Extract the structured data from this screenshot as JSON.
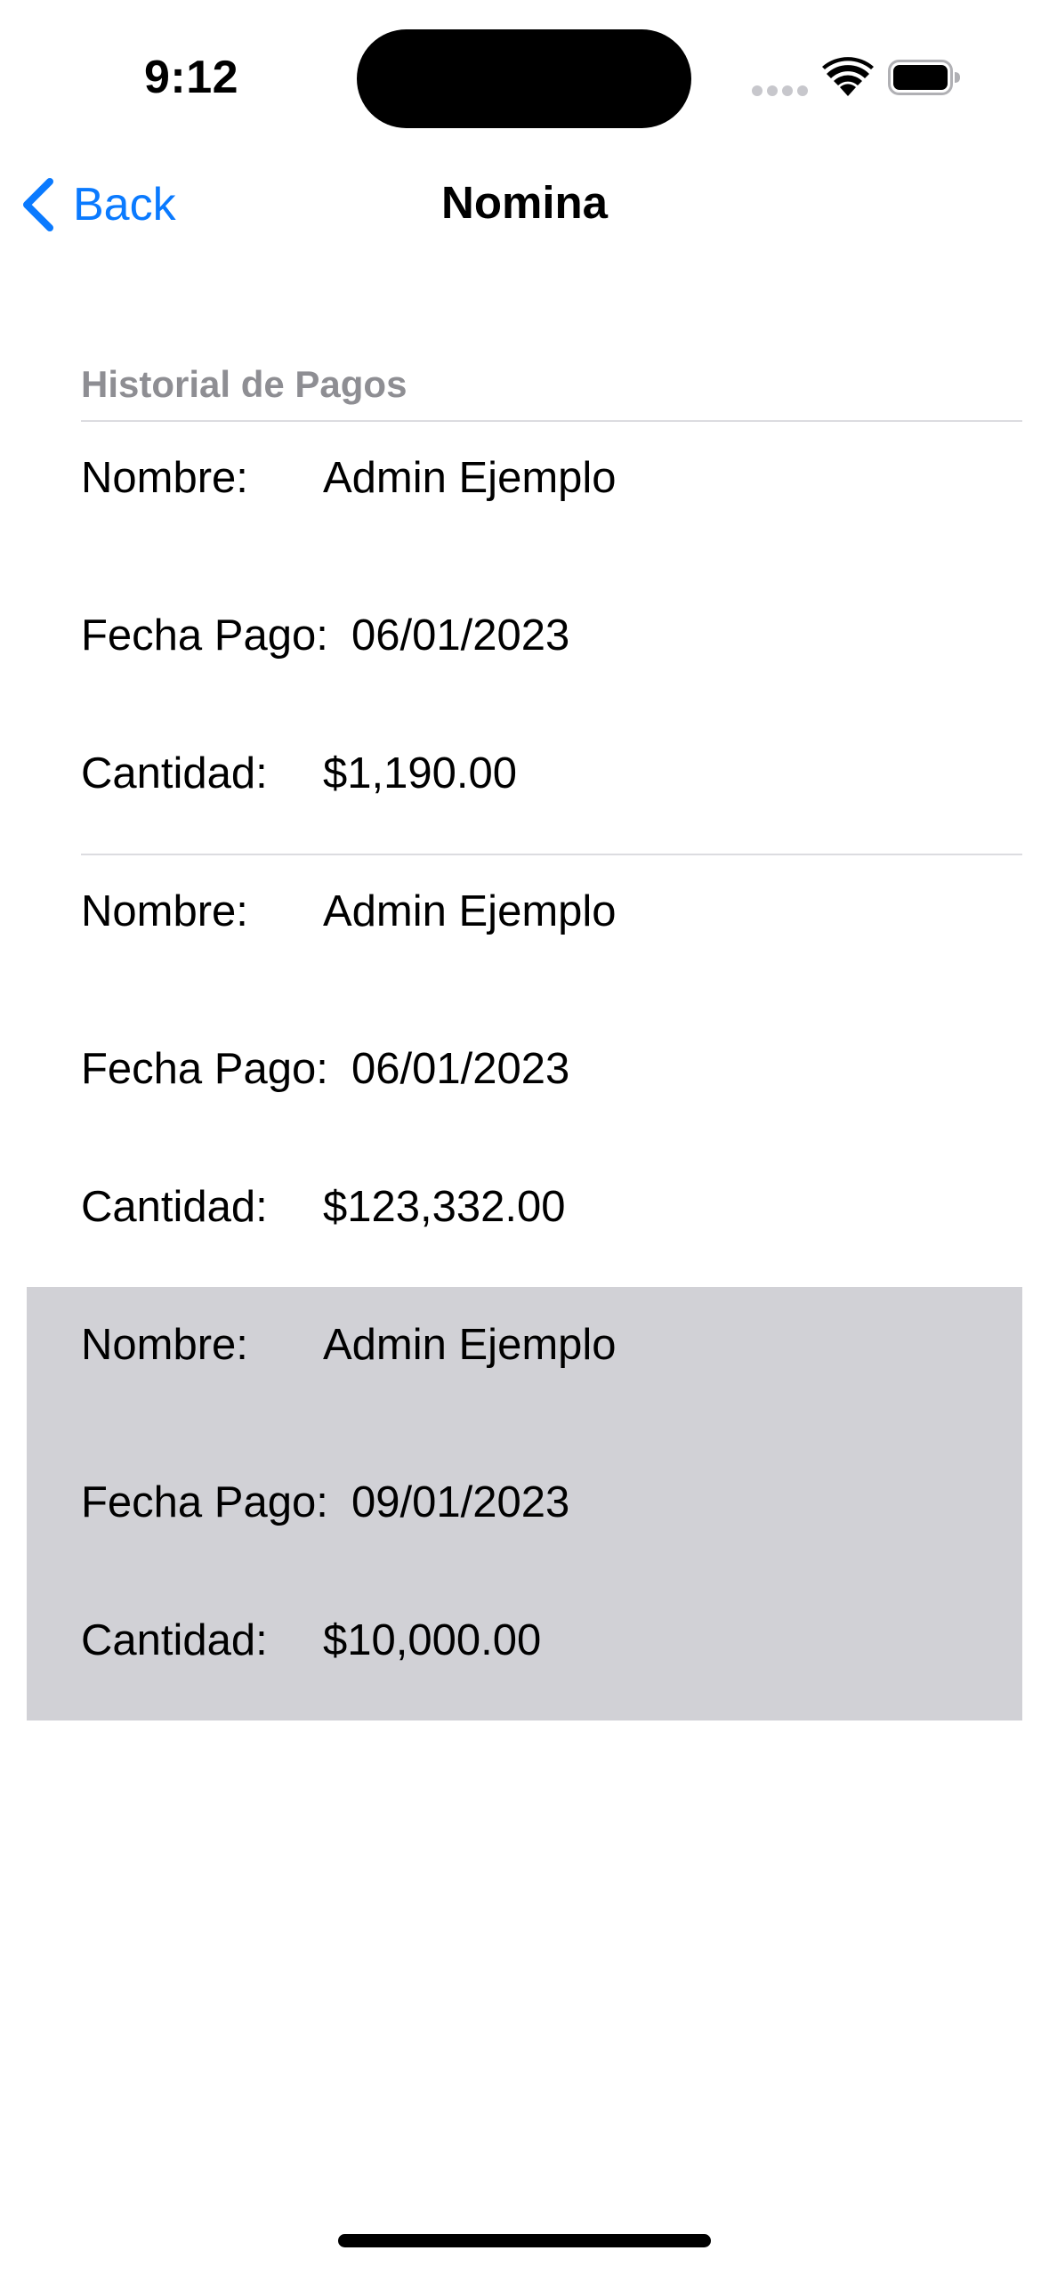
{
  "status_bar": {
    "time": "9:12",
    "icons": [
      "signal-dots-icon",
      "wifi-icon",
      "battery-icon"
    ]
  },
  "nav": {
    "back_label": "Back",
    "back_icon": "chevron-left-icon",
    "title": "Nomina",
    "accent_color": "#0a7aff"
  },
  "section": {
    "header": "Historial de Pagos"
  },
  "records": [
    {
      "name_label": "Nombre:",
      "name": "Admin Ejemplo",
      "date_label": "Fecha Pago:",
      "date": "06/01/2023",
      "amount_label": "Cantidad:",
      "amount": "$1,190.00",
      "selected": false
    },
    {
      "name_label": "Nombre:",
      "name": "Admin Ejemplo",
      "date_label": "Fecha Pago:",
      "date": "06/01/2023",
      "amount_label": "Cantidad:",
      "amount": "$123,332.00",
      "selected": false
    },
    {
      "name_label": "Nombre:",
      "name": "Admin Ejemplo",
      "date_label": "Fecha Pago:",
      "date": "09/01/2023",
      "amount_label": "Cantidad:",
      "amount": "$10,000.00",
      "selected": true
    }
  ],
  "colors": {
    "selected_row_bg": "#d1d1d6",
    "section_header": "#8e8e93"
  }
}
